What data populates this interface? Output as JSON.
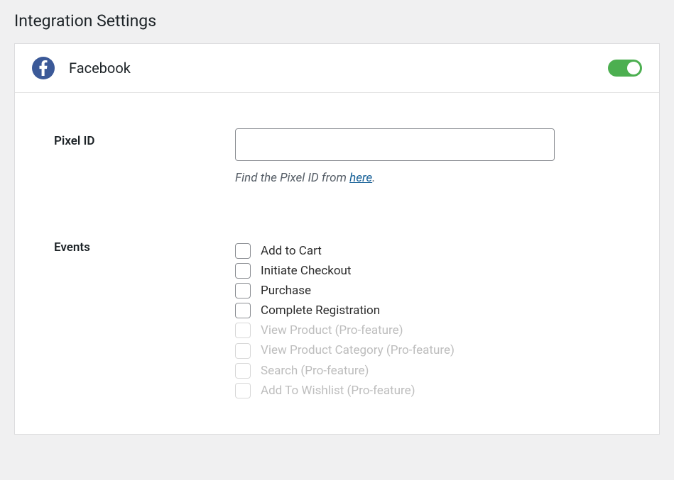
{
  "page": {
    "title": "Integration Settings"
  },
  "panel": {
    "title": "Facebook",
    "toggle_on": true
  },
  "form": {
    "pixel_id": {
      "label": "Pixel ID",
      "value": "",
      "helper_prefix": "Find the Pixel ID from ",
      "helper_link_text": "here",
      "helper_suffix": "."
    },
    "events": {
      "label": "Events",
      "items": [
        {
          "label": "Add to Cart",
          "disabled": false
        },
        {
          "label": "Initiate Checkout",
          "disabled": false
        },
        {
          "label": "Purchase",
          "disabled": false
        },
        {
          "label": "Complete Registration",
          "disabled": false
        },
        {
          "label": "View Product (Pro-feature)",
          "disabled": true
        },
        {
          "label": "View Product Category (Pro-feature)",
          "disabled": true
        },
        {
          "label": "Search (Pro-feature)",
          "disabled": true
        },
        {
          "label": "Add To Wishlist (Pro-feature)",
          "disabled": true
        }
      ]
    }
  }
}
